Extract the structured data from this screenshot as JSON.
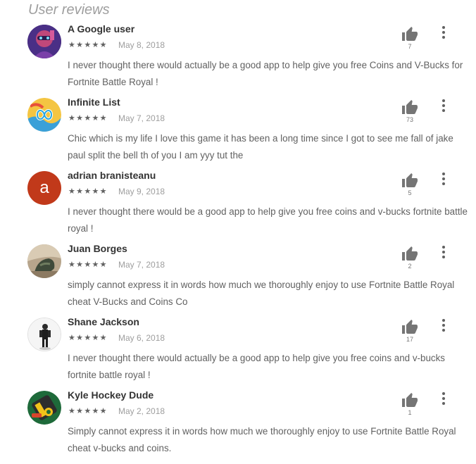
{
  "section": {
    "title": "User reviews"
  },
  "reviews": [
    {
      "author": "A Google user",
      "stars": "★★★★★",
      "date": "May 8, 2018",
      "helpful": "7",
      "text": "I never thought there would actually be a good app to help give you free Coins and V-Bucks for Fortnite Battle Royal !",
      "avatar_icon": "character-avatar-icon"
    },
    {
      "author": "Infinite List",
      "stars": "★★★★★",
      "date": "May 7, 2018",
      "helpful": "73",
      "text": "Chic which is my life I love this game it has been a long time since I got to see me fall of jake paul split the bell th of you I am yyy tut the",
      "avatar_icon": "infinity-avatar-icon"
    },
    {
      "author": "adrian branisteanu",
      "stars": "★★★★★",
      "date": "May 9, 2018",
      "helpful": "5",
      "text": "I never thought there would be a good app to help give you free coins and v-bucks fortnite battle royal !",
      "avatar_letter": "a",
      "avatar_color": "#c1391a"
    },
    {
      "author": "Juan Borges",
      "stars": "★★★★★",
      "date": "May 7, 2018",
      "helpful": "2",
      "text": "simply cannot express it in words how much we thoroughly enjoy to use Fortnite Battle Royal cheat V-Bucks and Coins Co",
      "avatar_icon": "photo-avatar-icon"
    },
    {
      "author": "Shane Jackson",
      "stars": "★★★★★",
      "date": "May 6, 2018",
      "helpful": "17",
      "text": "I never thought there would actually be a good app to help give you free coins and v-bucks fortnite battle royal !",
      "avatar_icon": "figure-avatar-icon"
    },
    {
      "author": "Kyle Hockey Dude",
      "stars": "★★★★★",
      "date": "May 2, 2018",
      "helpful": "1",
      "text": "Simply cannot express it in words how much we thoroughly enjoy to use Fortnite Battle Royal cheat v-bucks and coins.",
      "avatar_icon": "game-avatar-icon"
    }
  ]
}
